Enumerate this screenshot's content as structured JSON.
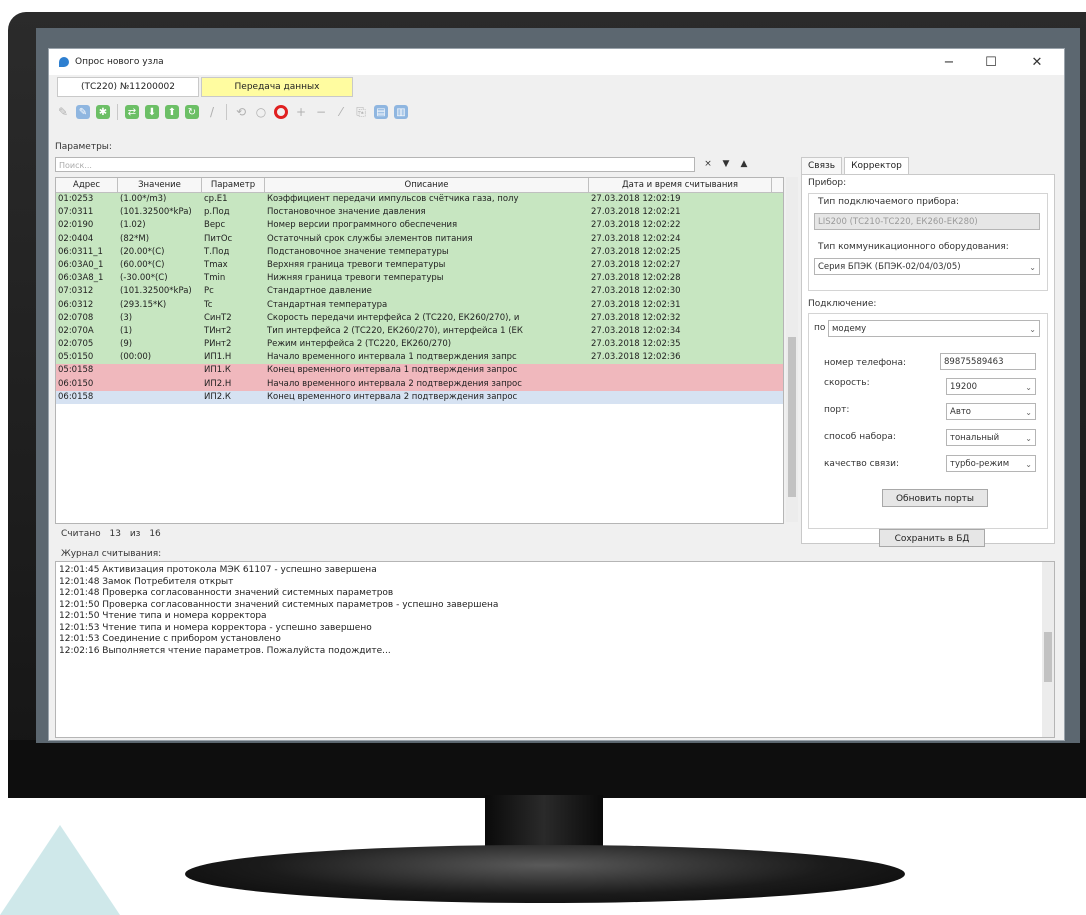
{
  "window": {
    "title": "Опрос нового узла",
    "minimize": "−",
    "maximize": "☐",
    "close": "✕"
  },
  "tabs": [
    {
      "label": "(ТС220) №11200002"
    },
    {
      "label": "Передача данных"
    }
  ],
  "params": {
    "label": "Параметры:",
    "search_placeholder": "Поиск...",
    "clear": "×",
    "down": "▼",
    "up": "▲",
    "columns": [
      "Адрес",
      "Значение",
      "Параметр",
      "Описание",
      "Дата и время считывания"
    ],
    "rows": [
      {
        "addr": "01:0253",
        "val": "(1.00*/m3)",
        "param": "cp.E1",
        "desc": "Коэффициент передачи импульсов счётчика газа, полу",
        "date": "27.03.2018 12:02:19",
        "state": "green"
      },
      {
        "addr": "07:0311",
        "val": "(101.32500*kPa)",
        "param": "p.Под",
        "desc": "Постановочное значение давления",
        "date": "27.03.2018 12:02:21",
        "state": "green"
      },
      {
        "addr": "02:0190",
        "val": "(1.02)",
        "param": "Верс",
        "desc": "Номер версии программного обеспечения",
        "date": "27.03.2018 12:02:22",
        "state": "green"
      },
      {
        "addr": "02:0404",
        "val": "(82*M)",
        "param": "ПитОс",
        "desc": "Остаточный срок службы элементов питания",
        "date": "27.03.2018 12:02:24",
        "state": "green"
      },
      {
        "addr": "06:0311_1",
        "val": "(20.00*(C)",
        "param": "Т.Под",
        "desc": "Подстановочное значение температуры",
        "date": "27.03.2018 12:02:25",
        "state": "green"
      },
      {
        "addr": "06:03A0_1",
        "val": "(60.00*(C)",
        "param": "Tmax",
        "desc": "Верхняя граница тревоги температуры",
        "date": "27.03.2018 12:02:27",
        "state": "green"
      },
      {
        "addr": "06:03A8_1",
        "val": "(-30.00*(C)",
        "param": "Tmin",
        "desc": "Нижняя граница тревоги температуры",
        "date": "27.03.2018 12:02:28",
        "state": "green"
      },
      {
        "addr": "07:0312",
        "val": "(101.32500*kPa)",
        "param": "Pc",
        "desc": "Стандартное давление",
        "date": "27.03.2018 12:02:30",
        "state": "green"
      },
      {
        "addr": "06:0312",
        "val": "(293.15*K)",
        "param": "Tc",
        "desc": "Стандартная температура",
        "date": "27.03.2018 12:02:31",
        "state": "green"
      },
      {
        "addr": "02:0708",
        "val": "(3)",
        "param": "СинТ2",
        "desc": "Скорость передачи интерфейса 2 (ТС220, ЕК260/270), и",
        "date": "27.03.2018 12:02:32",
        "state": "green"
      },
      {
        "addr": "02:070A",
        "val": "(1)",
        "param": "ТИнт2",
        "desc": "Тип интерфейса 2 (ТС220, ЕК260/270), интерфейса 1 (ЕК",
        "date": "27.03.2018 12:02:34",
        "state": "green"
      },
      {
        "addr": "02:0705",
        "val": "(9)",
        "param": "РИнт2",
        "desc": "Режим интерфейса 2 (ТС220, ЕК260/270)",
        "date": "27.03.2018 12:02:35",
        "state": "green"
      },
      {
        "addr": "05:0150",
        "val": "(00:00)",
        "param": "ИП1.Н",
        "desc": "Начало временного интервала 1 подтверждения запрс",
        "date": "27.03.2018 12:02:36",
        "state": "green"
      },
      {
        "addr": "05:0158",
        "val": "",
        "param": "ИП1.К",
        "desc": "Конец временного интервала 1 подтверждения запрос",
        "date": "",
        "state": "red"
      },
      {
        "addr": "06:0150",
        "val": "",
        "param": "ИП2.Н",
        "desc": "Начало временного интервала 2 подтверждения запрос",
        "date": "",
        "state": "red"
      },
      {
        "addr": "06:0158",
        "val": "",
        "param": "ИП2.К",
        "desc": "Конец временного интервала 2 подтверждения запрос",
        "date": "",
        "state": "sel"
      }
    ],
    "count_label": "Считано",
    "count_read": "13",
    "count_of": "из",
    "count_total": "16"
  },
  "journal": {
    "label": "Журнал считывания:",
    "lines": [
      "12:01:45  Активизация протокола МЭК 61107 - успешно завершена",
      "12:01:48  Замок Потребителя открыт",
      "12:01:48  Проверка согласованности значений системных параметров",
      "12:01:50  Проверка согласованности значений системных параметров - успешно завершена",
      "12:01:50  Чтение типа и номера корректора",
      "12:01:53  Чтение типа и номера корректора - успешно завершено",
      "12:01:53  Соединение с прибором установлено",
      "12:02:16  Выполняется чтение параметров. Пожалуйста подождите..."
    ]
  },
  "right": {
    "tabs": [
      "Связь",
      "Корректор"
    ],
    "device_label": "Прибор:",
    "device_type_label": "Тип подключаемого прибора:",
    "device_type_value": "LIS200 (ТС210-ТС220, ЕК260-ЕК280)",
    "comm_type_label": "Тип коммуникационного оборудования:",
    "comm_type_value": "Серия БПЭК (БПЭК-02/04/03/05)",
    "conn_label": "Подключение:",
    "by_label": "по",
    "by_value": "модему",
    "phone_label": "номер телефона:",
    "phone_value": "89875589463",
    "speed_label": "скорость:",
    "speed_value": "19200",
    "port_label": "порт:",
    "port_value": "Авто",
    "dial_label": "способ набора:",
    "dial_value": "тональный",
    "quality_label": "качество связи:",
    "quality_value": "турбо-режим",
    "refresh_ports": "Обновить порты",
    "save_db": "Сохранить в БД"
  },
  "colors": {
    "green_row": "#c7e6c1",
    "red_row": "#f0b8bd",
    "selected_row": "#d6e2f2",
    "tab_yellow": "#fffca0"
  }
}
